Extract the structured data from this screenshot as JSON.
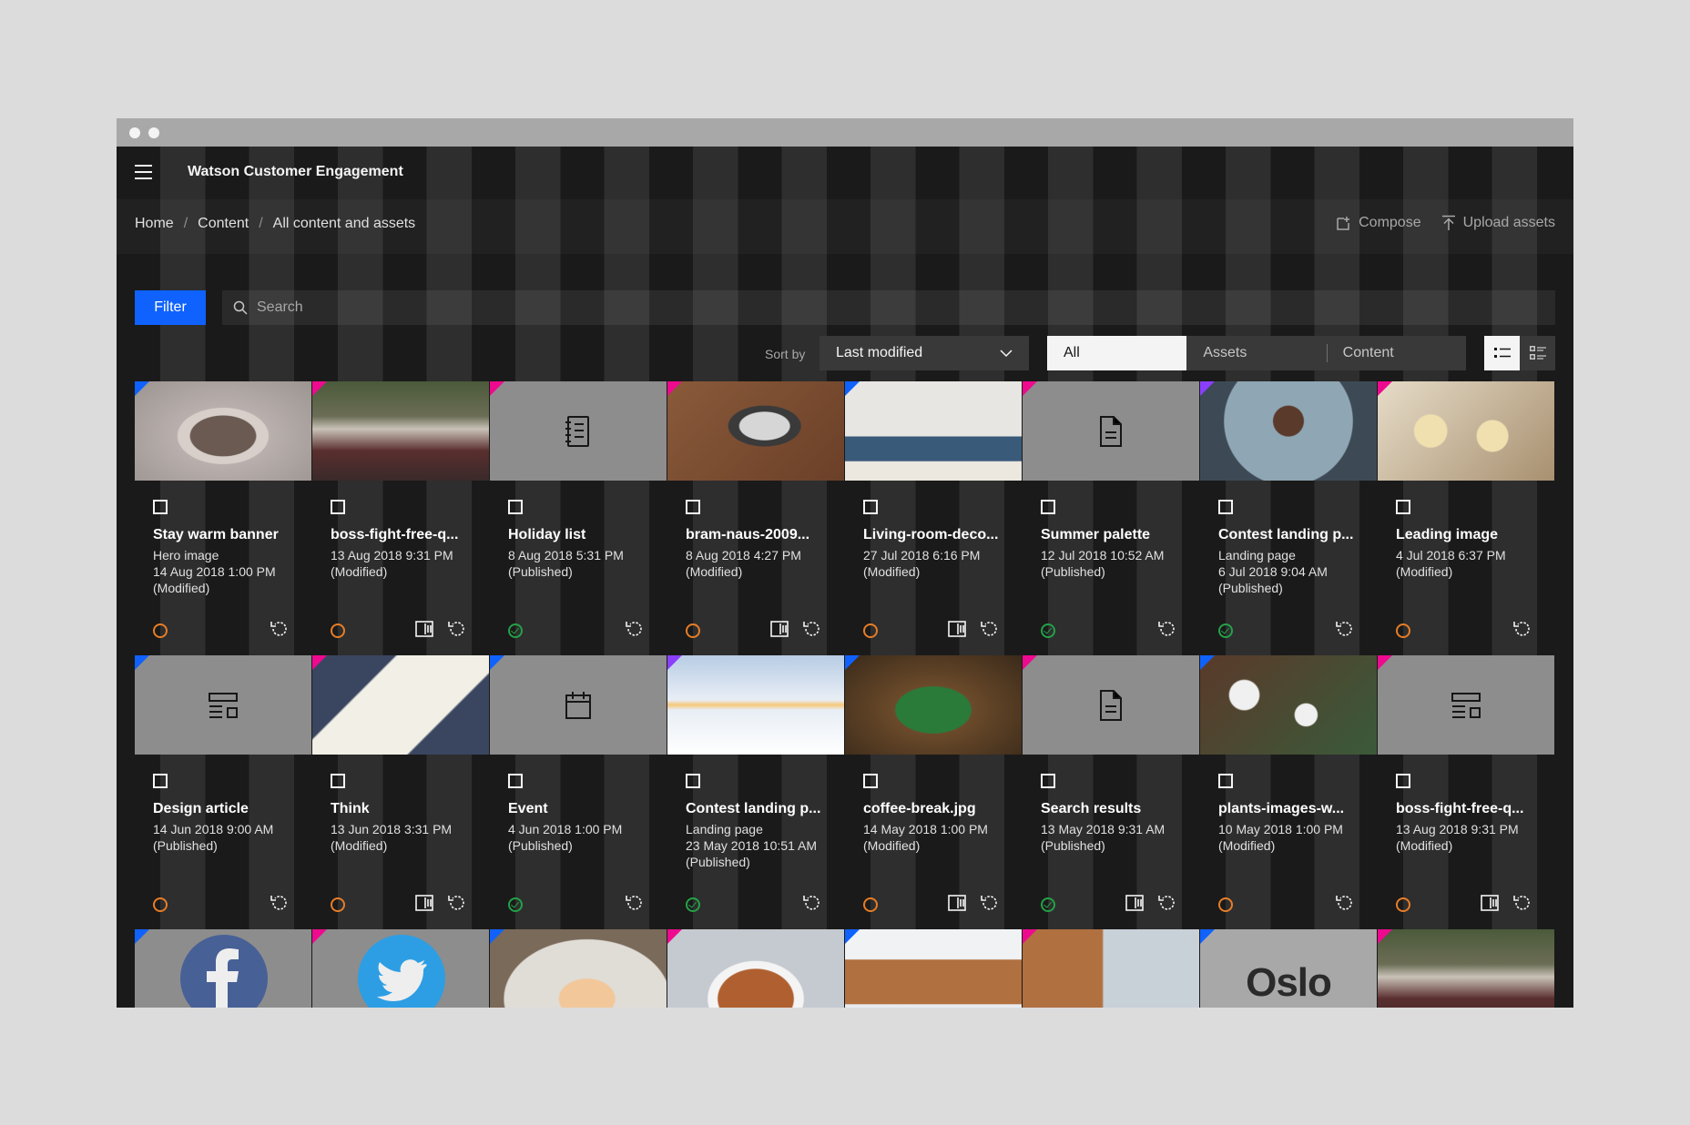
{
  "app": {
    "title": "Watson Customer Engagement",
    "breadcrumb": [
      "Home",
      "Content",
      "All content and assets"
    ],
    "actions": {
      "compose": "Compose",
      "upload": "Upload assets"
    },
    "filter_label": "Filter",
    "search_placeholder": "Search",
    "sort_label": "Sort by",
    "sort_value": "Last modified",
    "segments": [
      "All",
      "Assets",
      "Content"
    ],
    "active_segment": "All"
  },
  "colors": {
    "accent": "#0f62fe",
    "tag_blue": "#0f62fe",
    "tag_pink": "#ee0a8f",
    "tag_purple": "#8a3ffc",
    "status_draft": "#e77d27",
    "status_published": "#24a148"
  },
  "cards": [
    {
      "name": "Stay warm banner",
      "type": "Hero image",
      "date": "14 Aug 2018 1:00 PM",
      "status": "(Modified)",
      "thumb": "photo-mug",
      "tag": "blue",
      "published": false,
      "compare": false
    },
    {
      "name": "boss-fight-free-q...",
      "type": "",
      "date": "13 Aug 2018 9:31 PM",
      "status": "(Modified)",
      "thumb": "photo-woman-blanket",
      "tag": "pink",
      "published": false,
      "compare": true
    },
    {
      "name": "Holiday list",
      "type": "",
      "date": "8 Aug 2018 5:31 PM",
      "status": "(Published)",
      "thumb": "list-icon",
      "tag": "pink",
      "published": true,
      "compare": false
    },
    {
      "name": "bram-naus-2009...",
      "type": "",
      "date": "8 Aug 2018 4:27 PM",
      "status": "(Modified)",
      "thumb": "photo-laptop",
      "tag": "pink",
      "published": false,
      "compare": true
    },
    {
      "name": "Living-room-deco...",
      "type": "",
      "date": "27 Jul 2018 6:16 PM",
      "status": "(Modified)",
      "thumb": "photo-livingroom",
      "tag": "blue",
      "published": false,
      "compare": true
    },
    {
      "name": "Summer palette",
      "type": "",
      "date": "12 Jul 2018 10:52 AM",
      "status": "(Published)",
      "thumb": "document-icon",
      "tag": "pink",
      "published": true,
      "compare": false
    },
    {
      "name": "Contest landing p...",
      "type": "Landing page",
      "date": "6 Jul 2018 9:04 AM",
      "status": "(Published)",
      "thumb": "photo-sparkler",
      "tag": "purple",
      "published": true,
      "compare": false
    },
    {
      "name": "Leading image",
      "type": "",
      "date": "4 Jul 2018 6:37 PM",
      "status": "(Modified)",
      "thumb": "photo-dough",
      "tag": "pink",
      "published": false,
      "compare": false
    },
    {
      "name": "Design article",
      "type": "",
      "date": "14 Jun 2018 9:00 AM",
      "status": "(Published)",
      "thumb": "layout-icon",
      "tag": "blue",
      "published": false,
      "compare": false
    },
    {
      "name": "Think",
      "type": "",
      "date": "13 Jun 2018 3:31 PM",
      "status": "(Modified)",
      "thumb": "photo-notebook",
      "tag": "pink",
      "published": false,
      "compare": true
    },
    {
      "name": "Event",
      "type": "",
      "date": "4 Jun 2018 1:00 PM",
      "status": "(Published)",
      "thumb": "calendar-icon",
      "tag": "blue",
      "published": true,
      "compare": false
    },
    {
      "name": "Contest landing p...",
      "type": "Landing page",
      "date": "23 May 2018 10:51 AM",
      "status": "(Published)",
      "thumb": "photo-snowscape",
      "tag": "purple",
      "published": true,
      "compare": false
    },
    {
      "name": "coffee-break.jpg",
      "type": "",
      "date": "14 May 2018 1:00 PM",
      "status": "(Modified)",
      "thumb": "photo-green-cup",
      "tag": "blue",
      "published": false,
      "compare": true
    },
    {
      "name": "Search results",
      "type": "",
      "date": "13 May 2018 9:31 AM",
      "status": "(Published)",
      "thumb": "document-icon",
      "tag": "pink",
      "published": true,
      "compare": true
    },
    {
      "name": "plants-images-w...",
      "type": "",
      "date": "10 May 2018 1:00 PM",
      "status": "(Modified)",
      "thumb": "photo-plants",
      "tag": "blue",
      "published": false,
      "compare": false
    },
    {
      "name": "boss-fight-free-q...",
      "type": "",
      "date": "13 Aug 2018 9:31 PM",
      "status": "(Modified)",
      "thumb": "layout-icon",
      "tag": "pink",
      "published": false,
      "compare": true
    }
  ],
  "row3": [
    {
      "thumb": "facebook-logo",
      "tag": "blue"
    },
    {
      "thumb": "twitter-logo",
      "tag": "pink"
    },
    {
      "thumb": "photo-fireplace",
      "tag": "blue"
    },
    {
      "thumb": "photo-cocoa",
      "tag": "pink"
    },
    {
      "thumb": "photo-cabin",
      "tag": "blue"
    },
    {
      "thumb": "photo-cabin-trees",
      "tag": "pink"
    },
    {
      "thumb": "oslo-logo",
      "tag": "blue",
      "text": "Oslo"
    },
    {
      "thumb": "photo-woman-blanket",
      "tag": "pink"
    }
  ]
}
